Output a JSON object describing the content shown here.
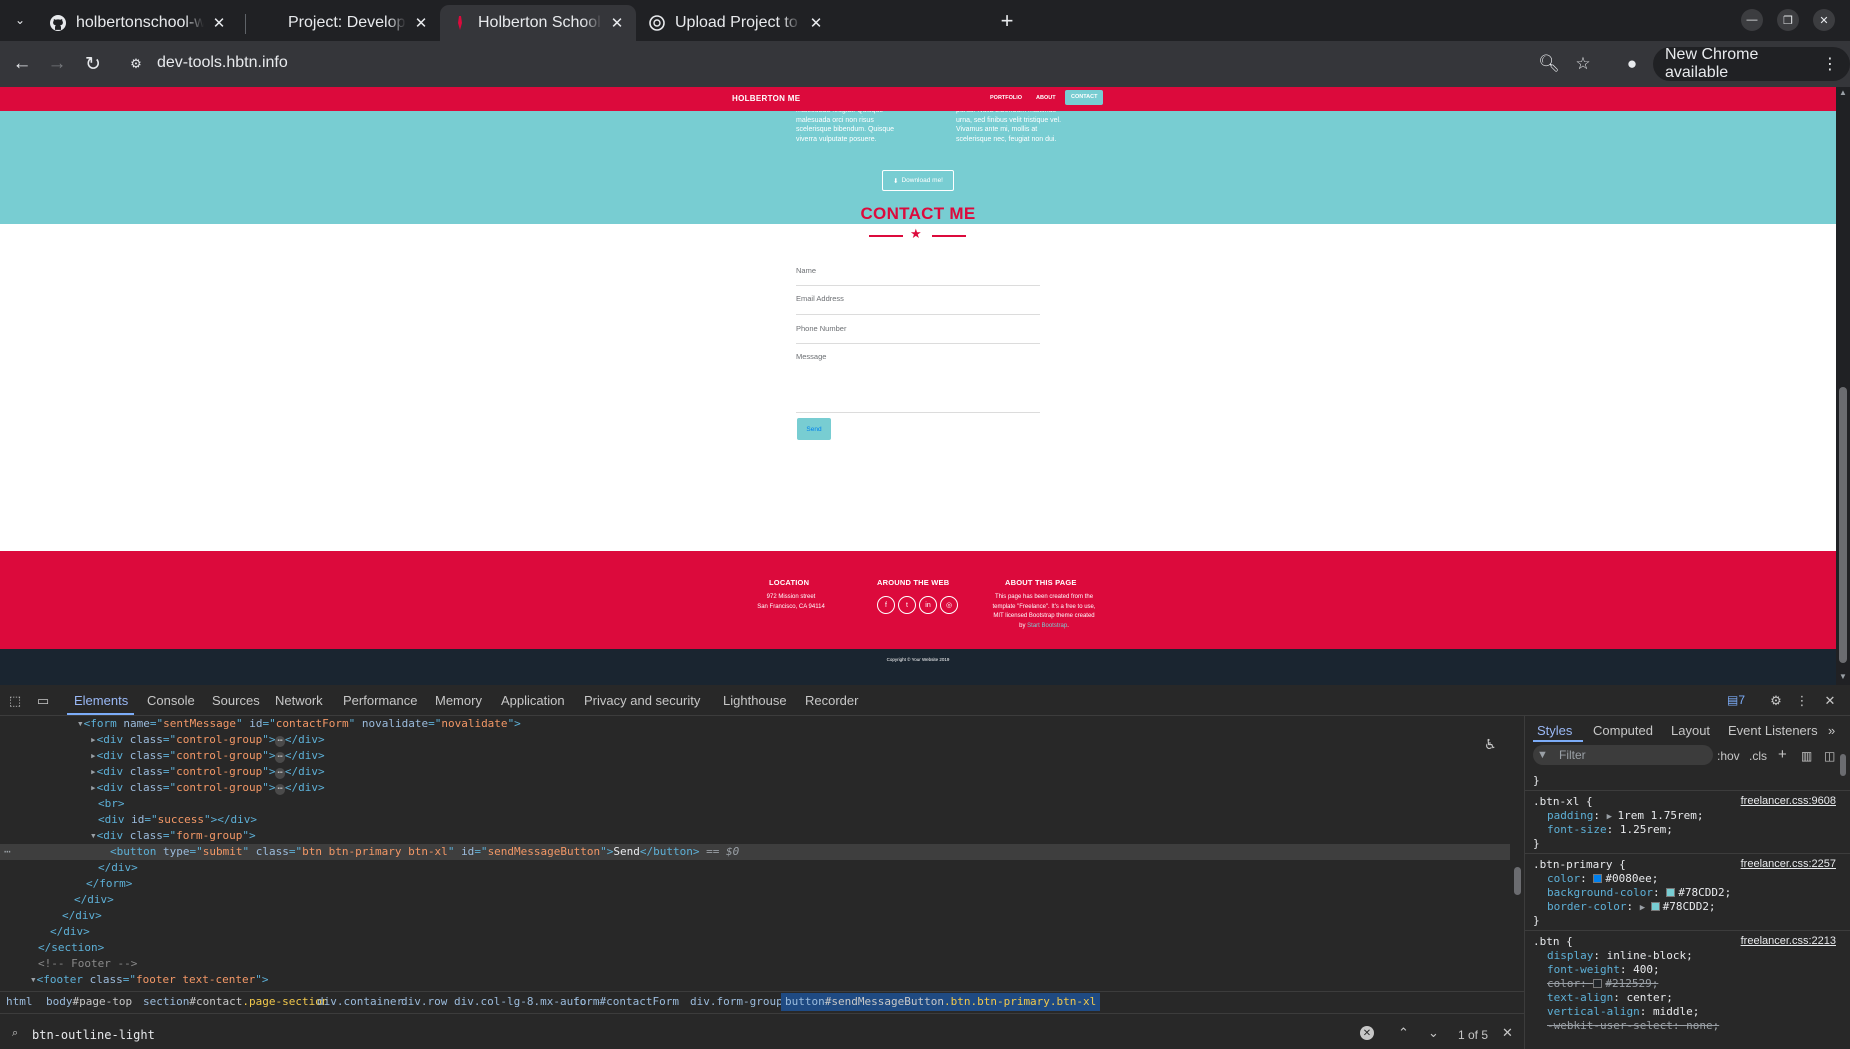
{
  "browser": {
    "tabs": [
      {
        "title": "holbertonschool-web_fro",
        "favicon": "github-icon",
        "active": false
      },
      {
        "title": "Project: Developer tools",
        "favicon": "holberton-icon",
        "active": false
      },
      {
        "title": "Holberton School - Devel",
        "favicon": "holberton-icon",
        "active": true
      },
      {
        "title": "Upload Project to GitHub",
        "favicon": "openai-icon",
        "active": false
      }
    ],
    "url": "dev-tools.hbtn.info",
    "update_label": "New Chrome available"
  },
  "site": {
    "brand": "HOLBERTON ME",
    "nav": [
      "PORTFOLIO",
      "ABOUT",
      "CONTACT"
    ],
    "about_left": "malesuada feugiat. Quisque malesuada orci non risus scelerisque bibendum. Quisque viverra vulputate posuere.",
    "about_right": "purus. Nulla bibendum maximus urna, sed finibus velit tristique vel. Vivamus ante mi, mollis at scelerisque nec, feugiat non dui.",
    "download_label": "Download me!",
    "contact_title": "CONTACT ME",
    "fields": [
      "Name",
      "Email Address",
      "Phone Number",
      "Message"
    ],
    "send_label": "Send",
    "footer": {
      "location_title": "LOCATION",
      "location_line1": "972 Mission street",
      "location_line2": "San Francisco, CA 94114",
      "web_title": "AROUND THE WEB",
      "about_title": "ABOUT THIS PAGE",
      "about_line1": "This page has been created from the",
      "about_line2": "template \"Freelance\". It's a free to use,",
      "about_line3": "MIT licensed Bootstrap theme created",
      "about_line4_prefix": "by ",
      "about_link": "Start Bootstrap",
      "about_line4_suffix": "."
    },
    "copyright": "Copyright © Your Website 2019"
  },
  "devtools": {
    "tabs": [
      "Elements",
      "Console",
      "Sources",
      "Network",
      "Performance",
      "Memory",
      "Application",
      "Privacy and security",
      "Lighthouse",
      "Recorder"
    ],
    "issues_count": "7",
    "dom": {
      "form_open_tag": "form",
      "form_name_attr": "name",
      "form_name_val": "sentMessage",
      "form_id_attr": "id",
      "form_id_val": "contactForm",
      "form_nv_attr": "novalidate",
      "form_nv_val": "novalidate",
      "control_group": "control-group",
      "success_id": "success",
      "form_group": "form-group",
      "button_type": "submit",
      "button_class": "btn btn-primary btn-xl",
      "button_id": "sendMessageButton",
      "button_text": "Send",
      "selected_marker": "== $0",
      "footer_comment": "<!-- Footer -->",
      "footer_class": "footer text-center"
    },
    "breadcrumbs": [
      {
        "tag": "html",
        "id": "",
        "cls": ""
      },
      {
        "tag": "body",
        "id": "#page-top",
        "cls": ""
      },
      {
        "tag": "section",
        "id": "#contact",
        "cls": ".page-section"
      },
      {
        "tag": "div",
        "id": "",
        "cls": ".container"
      },
      {
        "tag": "div",
        "id": "",
        "cls": ".row"
      },
      {
        "tag": "div",
        "id": "",
        "cls": ".col-lg-8.mx-auto"
      },
      {
        "tag": "form",
        "id": "#contactForm",
        "cls": ""
      },
      {
        "tag": "div",
        "id": "",
        "cls": ".form-group"
      },
      {
        "tag": "button",
        "id": "#sendMessageButton",
        "cls": ".btn.btn-primary.btn-xl"
      }
    ],
    "search": {
      "query": "btn-outline-light",
      "count": "1 of 5"
    },
    "styles": {
      "tabs": [
        "Styles",
        "Computed",
        "Layout",
        "Event Listeners"
      ],
      "filter_placeholder": "Filter",
      "hov": ":hov",
      "cls": ".cls",
      "rules": [
        {
          "selector": ".btn-xl {",
          "source": "freelancer.css:9608",
          "props": [
            {
              "name": "padding",
              "value": "1rem 1.75rem;",
              "expand": true
            },
            {
              "name": "font-size",
              "value": "1.25rem;"
            }
          ]
        },
        {
          "selector": ".btn-primary {",
          "source": "freelancer.css:2257",
          "props": [
            {
              "name": "color",
              "value": "#0080ee;",
              "swatch": "#0080ee"
            },
            {
              "name": "background-color",
              "value": "#78CDD2;",
              "swatch": "#78CDD2"
            },
            {
              "name": "border-color",
              "value": "#78CDD2;",
              "swatch": "#78CDD2",
              "expand": true
            }
          ]
        },
        {
          "selector": ".btn {",
          "source": "freelancer.css:2213",
          "props": [
            {
              "name": "display",
              "value": "inline-block;"
            },
            {
              "name": "font-weight",
              "value": "400;"
            },
            {
              "name": "color",
              "value": "#212529;",
              "swatch": "#212529",
              "struck": true
            },
            {
              "name": "text-align",
              "value": "center;"
            },
            {
              "name": "vertical-align",
              "value": "middle;"
            },
            {
              "name": "-webkit-user-select",
              "value": "none;",
              "struck": true
            }
          ]
        }
      ]
    }
  },
  "colors": {
    "brand_red": "#dc0a3c",
    "brand_teal": "#78cdd2",
    "devtools_bg": "#282828",
    "chrome_bg": "#202124"
  }
}
